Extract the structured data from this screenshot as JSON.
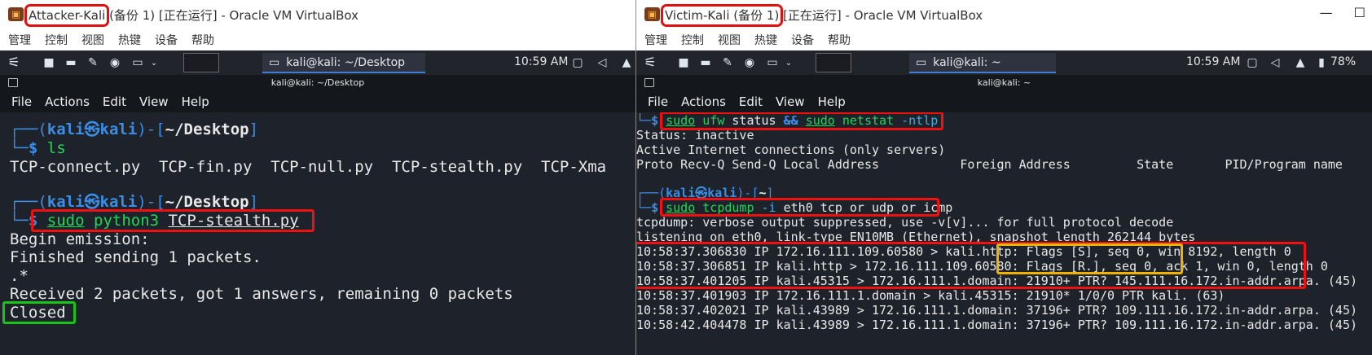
{
  "left": {
    "vb_title_highlight": "Attacker-Kali",
    "vb_title_rest": " (备份 1) [正在运行] - Oracle VM VirtualBox",
    "vb_menu": [
      "管理",
      "控制",
      "视图",
      "热键",
      "设备",
      "帮助"
    ],
    "taskbar_window": "kali@kali: ~/Desktop",
    "clock": "10:59 AM",
    "term_title": "kali@kali: ~/Desktop",
    "term_menu": [
      "File",
      "Actions",
      "Edit",
      "View",
      "Help"
    ],
    "prompt1_user": "kali",
    "prompt1_at": "㉿",
    "prompt1_host": "kali",
    "prompt1_dir": "~/Desktop",
    "cmd1": "ls",
    "ls_output": "TCP-connect.py  TCP-fin.py  TCP-null.py  TCP-stealth.py  TCP-Xma",
    "prompt2_user": "kali",
    "prompt2_at": "㉿",
    "prompt2_host": "kali",
    "prompt2_dir": "~/Desktop",
    "cmd2_sudo": "sudo",
    "cmd2_py": "python3",
    "cmd2_file": "TCP-stealth.py",
    "out1": "Begin emission:",
    "out2": "Finished sending 1 packets.",
    "out3": ".*",
    "out4": "Received 2 packets, got 1 answers, remaining 0 packets",
    "out5": "Closed"
  },
  "right": {
    "vb_title_highlight": "Victim-Kali (备份 1)",
    "vb_title_rest": " [正在运行] - Oracle VM VirtualBox",
    "vb_menu": [
      "管理",
      "控制",
      "视图",
      "热键",
      "设备",
      "帮助"
    ],
    "taskbar_window": "kali@kali: ~",
    "clock": "10:59 AM",
    "battery": "78%",
    "term_title": "kali@kali: ~",
    "term_menu": [
      "File",
      "Actions",
      "Edit",
      "View",
      "Help"
    ],
    "cmd1_sudo": "sudo",
    "cmd1_a": "ufw",
    "cmd1_b": "status",
    "cmd1_and": "&&",
    "cmd1_sudo2": "sudo",
    "cmd1_c": "netstat",
    "cmd1_d": "-ntlp",
    "status": "Status: inactive",
    "active": "Active Internet connections (only servers)",
    "header": "Proto Recv-Q Send-Q Local Address           Foreign Address         State       PID/Program name",
    "prompt2_user": "kali",
    "prompt2_at": "㉿",
    "prompt2_host": "kali",
    "prompt2_dir": "~",
    "cmd2_sudo": "sudo",
    "cmd2_rest": "tcpdump",
    "cmd2_flag": "-i",
    "cmd2_args": "eth0 tcp or udp or icmp",
    "td1": "tcpdump: verbose output suppressed, use -v[v]... for full protocol decode",
    "td2": "listening on eth0, link-type EN10MB (Ethernet), snapshot length 262144 bytes",
    "p1": "10:58:37.306830 IP 172.16.111.109.60580 > kali.http: Flags [S], seq 0, win 8192, length 0",
    "p2": "10:58:37.306851 IP kali.http > 172.16.111.109.60580: Flags [R.], seq 0, ack 1, win 0, length 0",
    "p3": "10:58:37.401205 IP kali.45315 > 172.16.111.1.domain: 21910+ PTR? 145.111.16.172.in-addr.arpa. (45)",
    "p4": "10:58:37.401903 IP 172.16.111.1.domain > kali.45315: 21910* 1/0/0 PTR kali. (63)",
    "p5": "10:58:37.402021 IP kali.43989 > 172.16.111.1.domain: 37196+ PTR? 109.111.16.172.in-addr.arpa. (45)",
    "p6": "10:58:42.404478 IP kali.43989 > 172.16.111.1.domain: 37196+ PTR? 109.111.16.172.in-addr.arpa. (45)"
  }
}
